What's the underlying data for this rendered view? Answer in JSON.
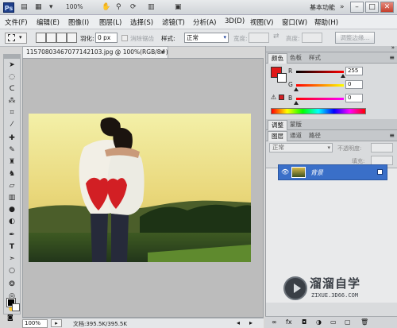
{
  "titlebar": {
    "logo": "Ps",
    "zoom": "100%",
    "workspace": "基本功能",
    "icons": [
      "document-open-icon",
      "launch-bridge-icon",
      "hand-tool-icon",
      "zoom-tool-icon",
      "rotate-view-icon",
      "arrange-documents-icon",
      "screen-mode-icon"
    ]
  },
  "window_controls": {
    "minimize": "–",
    "maximize": "□",
    "close": "✕"
  },
  "menu": [
    "文件(F)",
    "编辑(E)",
    "图像(I)",
    "图层(L)",
    "选择(S)",
    "滤镜(T)",
    "分析(A)",
    "3D(D)",
    "视图(V)",
    "窗口(W)",
    "帮助(H)"
  ],
  "options": {
    "feather_label": "羽化:",
    "feather_value": "0 px",
    "antialias_label": "消除锯齿",
    "style_label": "样式:",
    "style_value": "正常",
    "width_label": "宽度:",
    "height_label": "高度:",
    "refine_edge_button": "调整边缘..."
  },
  "document": {
    "tab_title": "11570803467077142103.jpg @ 100%(RGB/8#)",
    "zoom": "100%",
    "info": "文档:395.5K/395.5K"
  },
  "color_panel": {
    "tabs": [
      "颜色",
      "色板",
      "样式"
    ],
    "channels": [
      {
        "label": "R",
        "value": "255"
      },
      {
        "label": "G",
        "value": "0"
      },
      {
        "label": "B",
        "value": "0"
      }
    ],
    "foreground_color": "#e01818"
  },
  "adjust_panel": {
    "tabs": [
      "调整",
      "蒙版"
    ]
  },
  "layers_panel": {
    "tabs": [
      "图层",
      "通道",
      "路径"
    ],
    "blend_mode": "正常",
    "opacity_label": "不透明度:",
    "fill_label": "填充:",
    "layer_name": "背景"
  },
  "watermark": {
    "title": "溜溜自学",
    "subtitle": "ZIXUE.3D66.COM"
  }
}
